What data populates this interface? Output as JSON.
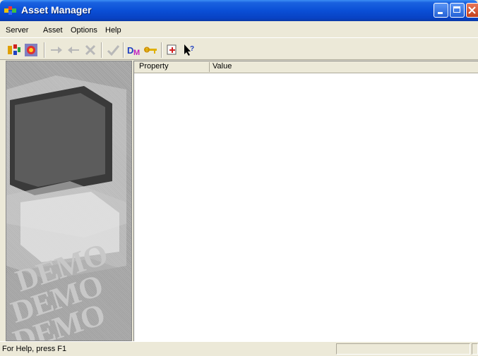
{
  "window": {
    "title": "Asset Manager"
  },
  "menu": [
    {
      "label": "Server"
    },
    {
      "label": "Asset"
    },
    {
      "label": "Options"
    },
    {
      "label": "Help"
    }
  ],
  "toolbar": {
    "buttons": [
      {
        "icon": "connect-icon",
        "enabled": true
      },
      {
        "icon": "disconnect-icon",
        "enabled": true
      },
      {
        "icon": "arrow-right-icon",
        "enabled": false
      },
      {
        "icon": "arrow-left-icon",
        "enabled": false
      },
      {
        "icon": "delete-icon",
        "enabled": false
      },
      {
        "icon": "checkmark-icon",
        "enabled": false
      },
      {
        "icon": "dm-icon",
        "enabled": true
      },
      {
        "icon": "key-icon",
        "enabled": true
      },
      {
        "icon": "export-icon",
        "enabled": true
      },
      {
        "icon": "context-help-icon",
        "enabled": true
      }
    ]
  },
  "splash": {
    "watermark": "DEMO"
  },
  "list": {
    "columns": [
      "Property",
      "Value"
    ],
    "rows": []
  },
  "status": {
    "text": "For Help, press F1"
  }
}
